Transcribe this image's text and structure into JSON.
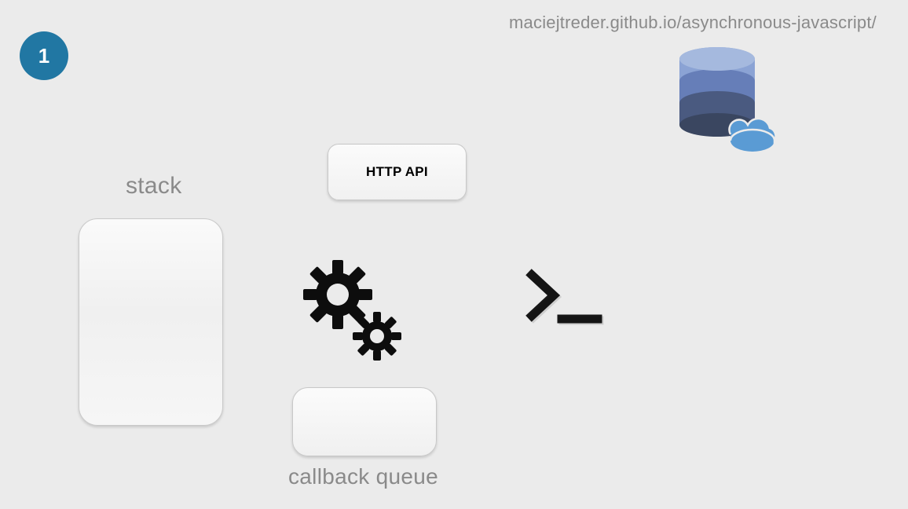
{
  "header": {
    "url": "maciejtreder.github.io/asynchronous-javascript/",
    "step_number": "1"
  },
  "labels": {
    "stack": "stack",
    "callback_queue": "callback queue",
    "http_api": "HTTP API"
  },
  "icons": {
    "gears": "gears-icon",
    "prompt": "terminal-prompt-icon",
    "database_cloud": "database-cloud-icon"
  },
  "colors": {
    "badge_bg": "#2177a3",
    "text_muted": "#8a8a8a",
    "db_top": "#8ba3d4",
    "db_mid": "#667eb8",
    "db_low": "#4a5a80",
    "db_bottom": "#3a4660",
    "cloud": "#5a9bd4"
  }
}
